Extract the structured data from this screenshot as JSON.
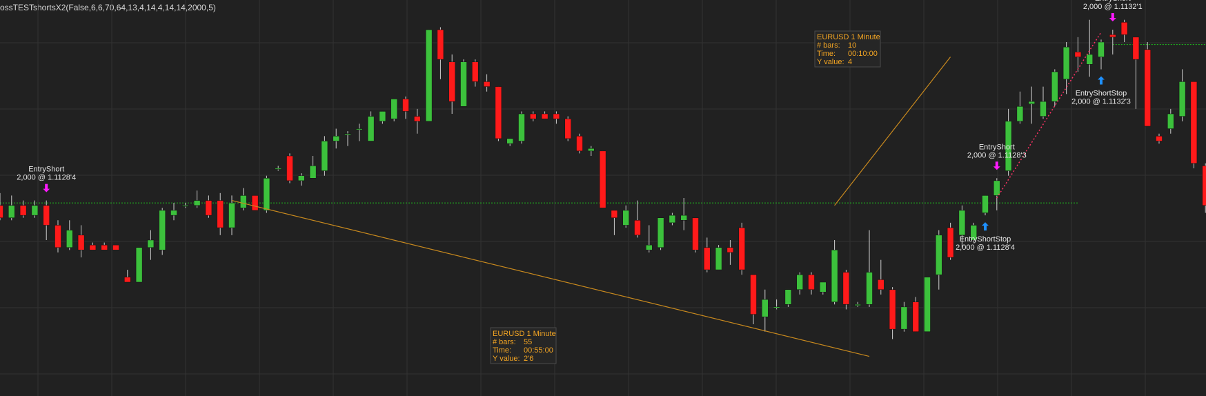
{
  "header": {
    "title": "ossTESTshortsX2(False,6,6,70,64,13,4,14,4,14,14,2000,5)"
  },
  "theme": {
    "background": "#212121",
    "grid": "#333333",
    "up": "#3cc13c",
    "down": "#ff1a1a",
    "wick": "#d0d0d0",
    "entry_arrow": "#ff1aff",
    "stop_arrow": "#1e90ff",
    "stopline": "#1fae1f",
    "measure": "#c8891e",
    "info_text": "#f5a623"
  },
  "chart_data": {
    "type": "candlestick",
    "symbol": "EURUSD",
    "timeframe": "1 Minute",
    "ylim": [
      1.11195,
      1.11355
    ],
    "grid": true,
    "candles": [
      {
        "o": 1.11272,
        "h": 1.11277,
        "l": 1.11266,
        "c": 1.11267
      },
      {
        "o": 1.11267,
        "h": 1.11276,
        "l": 1.11266,
        "c": 1.11272
      },
      {
        "o": 1.11272,
        "h": 1.11274,
        "l": 1.11267,
        "c": 1.11268
      },
      {
        "o": 1.11268,
        "h": 1.11274,
        "l": 1.11267,
        "c": 1.11272
      },
      {
        "o": 1.11272,
        "h": 1.11274,
        "l": 1.11258,
        "c": 1.11264
      },
      {
        "o": 1.11264,
        "h": 1.11266,
        "l": 1.11253,
        "c": 1.11255
      },
      {
        "o": 1.11255,
        "h": 1.11266,
        "l": 1.11254,
        "c": 1.11262
      },
      {
        "o": 1.1126,
        "h": 1.11264,
        "l": 1.11251,
        "c": 1.11254
      },
      {
        "o": 1.11256,
        "h": 1.11257,
        "l": 1.11254,
        "c": 1.11254
      },
      {
        "o": 1.11256,
        "h": 1.11257,
        "l": 1.11254,
        "c": 1.11254
      },
      {
        "o": 1.11256,
        "h": 1.11256,
        "l": 1.11254,
        "c": 1.11254
      },
      {
        "o": 1.11243,
        "h": 1.11246,
        "l": 1.11241,
        "c": 1.11241
      },
      {
        "o": 1.11241,
        "h": 1.11255,
        "l": 1.11241,
        "c": 1.11255
      },
      {
        "o": 1.11255,
        "h": 1.11262,
        "l": 1.1125,
        "c": 1.11258
      },
      {
        "o": 1.11254,
        "h": 1.11271,
        "l": 1.11252,
        "c": 1.1127
      },
      {
        "o": 1.11268,
        "h": 1.11273,
        "l": 1.11266,
        "c": 1.1127
      },
      {
        "o": 1.11272,
        "h": 1.11273,
        "l": 1.11271,
        "c": 1.11272
      },
      {
        "o": 1.11272,
        "h": 1.11278,
        "l": 1.11271,
        "c": 1.11274
      },
      {
        "o": 1.11274,
        "h": 1.11276,
        "l": 1.11267,
        "c": 1.11268
      },
      {
        "o": 1.11274,
        "h": 1.11277,
        "l": 1.1126,
        "c": 1.11263
      },
      {
        "o": 1.11263,
        "h": 1.11276,
        "l": 1.1126,
        "c": 1.11273
      },
      {
        "o": 1.11271,
        "h": 1.11279,
        "l": 1.1127,
        "c": 1.11276
      },
      {
        "o": 1.11276,
        "h": 1.11276,
        "l": 1.1127,
        "c": 1.1127
      },
      {
        "o": 1.1127,
        "h": 1.11284,
        "l": 1.11269,
        "c": 1.11283
      },
      {
        "o": 1.11287,
        "h": 1.11288,
        "l": 1.11286,
        "c": 1.11287
      },
      {
        "o": 1.11292,
        "h": 1.11293,
        "l": 1.11281,
        "c": 1.11282
      },
      {
        "o": 1.11282,
        "h": 1.11285,
        "l": 1.1128,
        "c": 1.11284
      },
      {
        "o": 1.11283,
        "h": 1.11292,
        "l": 1.11283,
        "c": 1.11288
      },
      {
        "o": 1.11286,
        "h": 1.113,
        "l": 1.11284,
        "c": 1.11298
      },
      {
        "o": 1.11298,
        "h": 1.11303,
        "l": 1.11295,
        "c": 1.113
      },
      {
        "o": 1.11301,
        "h": 1.11302,
        "l": 1.11296,
        "c": 1.11301
      },
      {
        "o": 1.11303,
        "h": 1.11305,
        "l": 1.11298,
        "c": 1.11303
      },
      {
        "o": 1.11298,
        "h": 1.1131,
        "l": 1.11298,
        "c": 1.11308
      },
      {
        "o": 1.11306,
        "h": 1.1131,
        "l": 1.11305,
        "c": 1.1131
      },
      {
        "o": 1.11307,
        "h": 1.11315,
        "l": 1.11306,
        "c": 1.11315
      },
      {
        "o": 1.11315,
        "h": 1.11316,
        "l": 1.11307,
        "c": 1.1131
      },
      {
        "o": 1.11308,
        "h": 1.11311,
        "l": 1.11301,
        "c": 1.11306
      },
      {
        "o": 1.11306,
        "h": 1.11343,
        "l": 1.11306,
        "c": 1.11343
      },
      {
        "o": 1.11343,
        "h": 1.11344,
        "l": 1.11323,
        "c": 1.11331
      },
      {
        "o": 1.1133,
        "h": 1.11333,
        "l": 1.11309,
        "c": 1.11314
      },
      {
        "o": 1.11312,
        "h": 1.11331,
        "l": 1.11312,
        "c": 1.1133
      },
      {
        "o": 1.1133,
        "h": 1.11331,
        "l": 1.1132,
        "c": 1.11322
      },
      {
        "o": 1.11322,
        "h": 1.11325,
        "l": 1.11318,
        "c": 1.1132
      },
      {
        "o": 1.1132,
        "h": 1.1132,
        "l": 1.11298,
        "c": 1.11299
      },
      {
        "o": 1.11297,
        "h": 1.11299,
        "l": 1.11296,
        "c": 1.11299
      },
      {
        "o": 1.11298,
        "h": 1.1131,
        "l": 1.11297,
        "c": 1.11309
      },
      {
        "o": 1.11309,
        "h": 1.1131,
        "l": 1.11306,
        "c": 1.11307
      },
      {
        "o": 1.11309,
        "h": 1.1131,
        "l": 1.11307,
        "c": 1.11307
      },
      {
        "o": 1.11309,
        "h": 1.1131,
        "l": 1.11305,
        "c": 1.11307
      },
      {
        "o": 1.11307,
        "h": 1.11308,
        "l": 1.11298,
        "c": 1.11299
      },
      {
        "o": 1.113,
        "h": 1.11301,
        "l": 1.11293,
        "c": 1.11294
      },
      {
        "o": 1.11294,
        "h": 1.11296,
        "l": 1.11292,
        "c": 1.11295
      },
      {
        "o": 1.11294,
        "h": 1.11294,
        "l": 1.11271,
        "c": 1.11271
      },
      {
        "o": 1.1127,
        "h": 1.1127,
        "l": 1.1126,
        "c": 1.11267
      },
      {
        "o": 1.11264,
        "h": 1.11272,
        "l": 1.11263,
        "c": 1.1127
      },
      {
        "o": 1.11266,
        "h": 1.11274,
        "l": 1.11259,
        "c": 1.1126
      },
      {
        "o": 1.11254,
        "h": 1.11264,
        "l": 1.11253,
        "c": 1.11256
      },
      {
        "o": 1.11255,
        "h": 1.11267,
        "l": 1.11254,
        "c": 1.11267
      },
      {
        "o": 1.11265,
        "h": 1.11269,
        "l": 1.11264,
        "c": 1.11268
      },
      {
        "o": 1.11266,
        "h": 1.11275,
        "l": 1.11262,
        "c": 1.11268
      },
      {
        "o": 1.11267,
        "h": 1.11267,
        "l": 1.11253,
        "c": 1.11254
      },
      {
        "o": 1.11255,
        "h": 1.11259,
        "l": 1.11245,
        "c": 1.11246
      },
      {
        "o": 1.11246,
        "h": 1.11256,
        "l": 1.11246,
        "c": 1.11255
      },
      {
        "o": 1.11255,
        "h": 1.11258,
        "l": 1.11248,
        "c": 1.11253
      },
      {
        "o": 1.11263,
        "h": 1.11265,
        "l": 1.11244,
        "c": 1.11246
      },
      {
        "o": 1.11244,
        "h": 1.11244,
        "l": 1.11224,
        "c": 1.11228
      },
      {
        "o": 1.11227,
        "h": 1.11238,
        "l": 1.11221,
        "c": 1.11234
      },
      {
        "o": 1.11231,
        "h": 1.11234,
        "l": 1.1123,
        "c": 1.11231
      },
      {
        "o": 1.11232,
        "h": 1.11238,
        "l": 1.11231,
        "c": 1.11238
      },
      {
        "o": 1.11238,
        "h": 1.11245,
        "l": 1.11236,
        "c": 1.11244
      },
      {
        "o": 1.11244,
        "h": 1.11245,
        "l": 1.11236,
        "c": 1.11238
      },
      {
        "o": 1.11237,
        "h": 1.11241,
        "l": 1.11236,
        "c": 1.11241
      },
      {
        "o": 1.11233,
        "h": 1.11258,
        "l": 1.11232,
        "c": 1.11254
      },
      {
        "o": 1.11245,
        "h": 1.11246,
        "l": 1.1123,
        "c": 1.11232
      },
      {
        "o": 1.11232,
        "h": 1.11233,
        "l": 1.11231,
        "c": 1.11232
      },
      {
        "o": 1.11232,
        "h": 1.11262,
        "l": 1.11231,
        "c": 1.11245
      },
      {
        "o": 1.11242,
        "h": 1.1125,
        "l": 1.11236,
        "c": 1.11238
      },
      {
        "o": 1.11238,
        "h": 1.11239,
        "l": 1.11218,
        "c": 1.11222
      },
      {
        "o": 1.11222,
        "h": 1.11233,
        "l": 1.11221,
        "c": 1.11231
      },
      {
        "o": 1.11233,
        "h": 1.11235,
        "l": 1.11221,
        "c": 1.11221
      },
      {
        "o": 1.11221,
        "h": 1.11243,
        "l": 1.11221,
        "c": 1.11243
      },
      {
        "o": 1.11244,
        "h": 1.11262,
        "l": 1.11238,
        "c": 1.1126
      },
      {
        "o": 1.11263,
        "h": 1.11265,
        "l": 1.1125,
        "c": 1.11251
      },
      {
        "o": 1.1126,
        "h": 1.11272,
        "l": 1.11255,
        "c": 1.1127
      },
      {
        "o": 1.11258,
        "h": 1.11265,
        "l": 1.11257,
        "c": 1.11264
      },
      {
        "o": 1.11269,
        "h": 1.11276,
        "l": 1.11268,
        "c": 1.11276
      },
      {
        "o": 1.11276,
        "h": 1.11283,
        "l": 1.1127,
        "c": 1.11282
      },
      {
        "o": 1.11286,
        "h": 1.11311,
        "l": 1.11284,
        "c": 1.11306
      },
      {
        "o": 1.11306,
        "h": 1.11318,
        "l": 1.11305,
        "c": 1.11312
      },
      {
        "o": 1.11313,
        "h": 1.1132,
        "l": 1.11305,
        "c": 1.11314
      },
      {
        "o": 1.11308,
        "h": 1.1132,
        "l": 1.11307,
        "c": 1.11314
      },
      {
        "o": 1.11314,
        "h": 1.11327,
        "l": 1.11312,
        "c": 1.11326
      },
      {
        "o": 1.11323,
        "h": 1.11338,
        "l": 1.11317,
        "c": 1.11336
      },
      {
        "o": 1.11334,
        "h": 1.1134,
        "l": 1.11326,
        "c": 1.11332
      },
      {
        "o": 1.11329,
        "h": 1.11347,
        "l": 1.11324,
        "c": 1.11333
      },
      {
        "o": 1.11332,
        "h": 1.11339,
        "l": 1.11327,
        "c": 1.11338
      },
      {
        "o": 1.11341,
        "h": 1.11343,
        "l": 1.11333,
        "c": 1.1134
      },
      {
        "o": 1.11346,
        "h": 1.11347,
        "l": 1.11338,
        "c": 1.11341
      },
      {
        "o": 1.1134,
        "h": 1.1134,
        "l": 1.11311,
        "c": 1.11331
      },
      {
        "o": 1.11335,
        "h": 1.11338,
        "l": 1.11304,
        "c": 1.11304
      },
      {
        "o": 1.113,
        "h": 1.11301,
        "l": 1.11297,
        "c": 1.11298
      },
      {
        "o": 1.11303,
        "h": 1.11311,
        "l": 1.11301,
        "c": 1.11309
      },
      {
        "o": 1.11308,
        "h": 1.11327,
        "l": 1.11306,
        "c": 1.11322
      },
      {
        "o": 1.11322,
        "h": 1.11322,
        "l": 1.11287,
        "c": 1.11289
      },
      {
        "o": 1.11288,
        "h": 1.11289,
        "l": 1.11269,
        "c": 1.11272
      },
      {
        "o": 1.11262,
        "h": 1.11262,
        "l": 1.11258,
        "c": 1.1126
      }
    ],
    "stop_levels": [
      {
        "price": 1.11273,
        "from": 0,
        "to": 93
      },
      {
        "price": 1.11337,
        "from": 96,
        "to": 106
      }
    ],
    "markers": [
      {
        "type": "entry",
        "bar": 4,
        "text1": "EntryShort",
        "text2": "2,000 @ 1.1128'4"
      },
      {
        "type": "entry",
        "bar": 86,
        "text1": "EntryShort",
        "text2": "2,000 @ 1.1128'3"
      },
      {
        "type": "entry",
        "bar": 96,
        "text1": "EntryShort",
        "text2": "2,000 @ 1.1132'1"
      },
      {
        "type": "stop",
        "bar": 85,
        "text1": "EntryShortStop",
        "text2": "2,000 @ 1.1128'4"
      },
      {
        "type": "stop",
        "bar": 95,
        "text1": "EntryShortStop",
        "text2": "2,000 @ 1.1132'3"
      }
    ],
    "measure_lines": [
      {
        "bar1": 20,
        "p1": 1.11274,
        "bar2": 75,
        "p2": 1.11211,
        "info": [
          {
            "label": "EURUSD 1 Minute",
            "value": ""
          },
          {
            "label": "# bars:",
            "value": "55"
          },
          {
            "label": "Time:",
            "value": "00:55:00"
          },
          {
            "label": "Y value:",
            "value": "2'6"
          }
        ]
      },
      {
        "bar1": 72,
        "p1": 1.11272,
        "bar2": 82,
        "p2": 1.11332,
        "info": [
          {
            "label": "EURUSD 1 Minute",
            "value": ""
          },
          {
            "label": "# bars:",
            "value": "10"
          },
          {
            "label": "Time:",
            "value": "00:10:00"
          },
          {
            "label": "Y value:",
            "value": "4"
          }
        ]
      }
    ],
    "trade_lines": [
      {
        "bar1": 86,
        "p1": 1.11275,
        "bar2": 95,
        "p2": 1.11342
      }
    ]
  }
}
